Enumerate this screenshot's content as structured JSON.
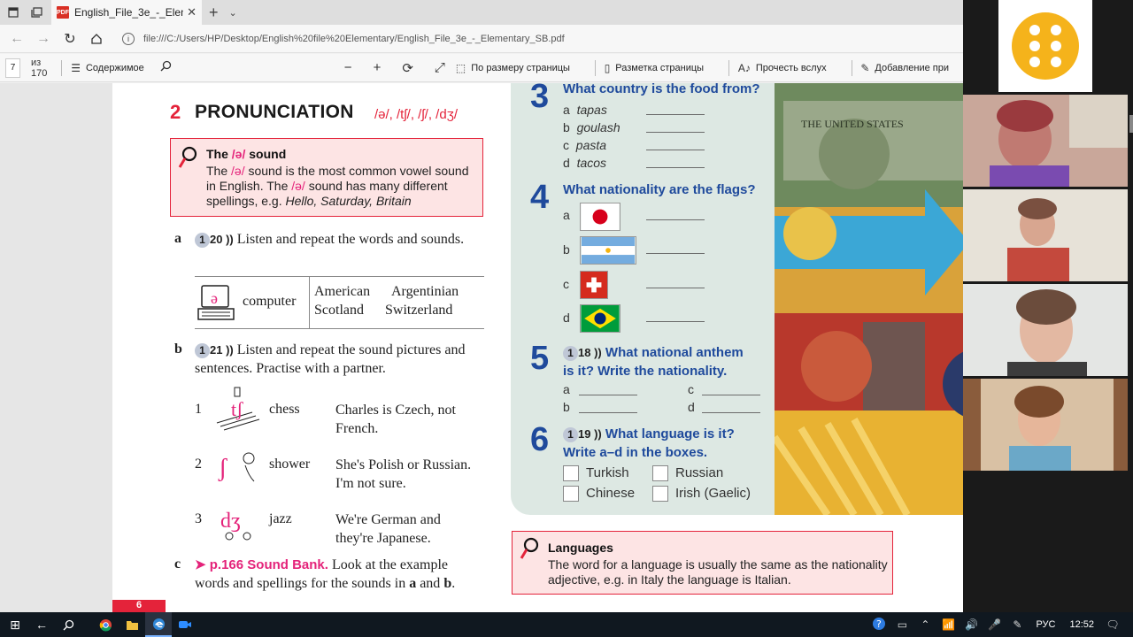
{
  "browser": {
    "tab_title": "English_File_3e_-_Eleme",
    "url": "file:///C:/Users/HP/Desktop/English%20file%20Elementary/English_File_3e_-_Elementary_SB.pdf"
  },
  "pdf_toolbar": {
    "page_number": "7",
    "page_total": "из 170",
    "contents_label": "Содержимое",
    "fit_page_label": "По размеру страницы",
    "layout_label": "Разметка страницы",
    "read_aloud_label": "Прочесть вслух",
    "add_notes_label": "Добавление при"
  },
  "left": {
    "section_number": "2",
    "section_title": "PRONUNCIATION",
    "section_ipa": "/ə/, /tʃ/, /ʃ/, /dʒ/",
    "sound_box": {
      "title_pre": "The ",
      "title_ipa": "/ə/",
      "title_post": " sound",
      "body_1": "The ",
      "body_ipa_1": "/ə/",
      "body_2": " sound is the most common vowel sound in English. The ",
      "body_ipa_2": "/ə/",
      "body_3": " sound has many different spellings, e.g. ",
      "examples": "Hello, Saturday, Britain"
    },
    "item_a": {
      "letter": "a",
      "audio_disc": "1",
      "audio_num": "20",
      "text": "Listen and repeat the words and sounds."
    },
    "table": {
      "word": "computer",
      "words": [
        "American",
        "Argentinian",
        "Scotland",
        "Switzerland"
      ]
    },
    "item_b": {
      "letter": "b",
      "audio_disc": "1",
      "audio_num": "21",
      "text": "Listen and repeat the sound pictures and sentences. Practise with a partner."
    },
    "sounds": [
      {
        "num": "1",
        "symbol": "tʃ",
        "word": "chess",
        "sentence_1": "Charles is Czech, not",
        "sentence_2": "French."
      },
      {
        "num": "2",
        "symbol": "ʃ",
        "word": "shower",
        "sentence_1": "She's Polish or Russian.",
        "sentence_2": "I'm not sure."
      },
      {
        "num": "3",
        "symbol": "dʒ",
        "word": "jazz",
        "sentence_1": "We're German and",
        "sentence_2": "they're Japanese."
      }
    ],
    "item_c": {
      "letter": "c",
      "link": "p.166 Sound Bank.",
      "text_1": " Look at the example",
      "text_2": "words and spellings for the sounds in ",
      "a": "a",
      "and": " and ",
      "b": "b",
      "dot": "."
    },
    "page_tab": "6"
  },
  "right": {
    "q3": {
      "num": "3",
      "title": "What country is the food from?",
      "options": [
        {
          "letter": "a",
          "text": "tapas"
        },
        {
          "letter": "b",
          "text": "goulash"
        },
        {
          "letter": "c",
          "text": "pasta"
        },
        {
          "letter": "d",
          "text": "tacos"
        }
      ]
    },
    "q4": {
      "num": "4",
      "title": "What nationality are the flags?",
      "letters": [
        "a",
        "b",
        "c",
        "d"
      ]
    },
    "q5": {
      "num": "5",
      "audio_disc": "1",
      "audio_num": "18",
      "title_1": "What national anthem",
      "title_2": "is it? Write the nationality.",
      "letters": [
        "a",
        "b",
        "c",
        "d"
      ]
    },
    "q6": {
      "num": "6",
      "audio_disc": "1",
      "audio_num": "19",
      "title_1": "What language is it?",
      "title_2": "Write a–d in the boxes.",
      "choices": [
        "Turkish",
        "Russian",
        "Chinese",
        "Irish (Gaelic)"
      ]
    },
    "languages_box": {
      "title": "Languages",
      "body": "The word for a language is usually the same as the nationality adjective, e.g. in Italy the language is Italian."
    }
  },
  "taskbar": {
    "lang": "РУС",
    "time": "12:52"
  },
  "colors": {
    "accent_red": "#e4233a",
    "accent_pink": "#e4237a",
    "question_blue": "#1f4a9c",
    "panel_green": "#dde8e3",
    "logo_yellow": "#f5b31b"
  },
  "icons": [
    "window-icon",
    "tabs-icon",
    "pdf-icon",
    "close-icon",
    "new-tab-icon",
    "chevron-down-icon",
    "back-icon",
    "forward-icon",
    "refresh-icon",
    "home-icon",
    "info-icon",
    "list-icon",
    "search-icon",
    "zoom-out-icon",
    "zoom-in-icon",
    "rotate-icon",
    "fullscreen-icon",
    "fit-page-icon",
    "layout-icon",
    "read-aloud-icon",
    "pen-icon",
    "windows-start-icon",
    "task-view-icon",
    "chrome-icon",
    "folder-icon",
    "edge-icon",
    "zoom-app-icon"
  ]
}
